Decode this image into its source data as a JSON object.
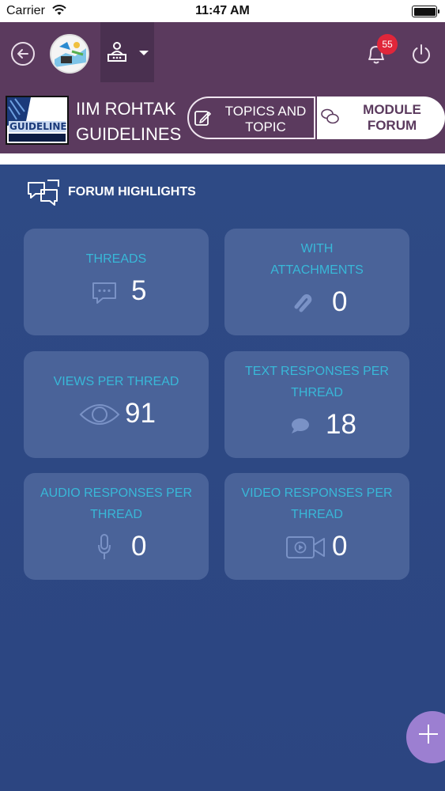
{
  "status_bar": {
    "carrier": "Carrier",
    "time": "11:47 AM"
  },
  "header": {
    "notification_count": "55",
    "course_title": "IIM ROHTAK GUIDELINES",
    "course_thumb_text": "GUIDELINES",
    "tabs": [
      {
        "label": "TOPICS AND TOPIC",
        "active": false
      },
      {
        "label": "MODULE FORUM",
        "active": true
      }
    ]
  },
  "forum_highlights": {
    "title": "FORUM HIGHLIGHTS",
    "cards": [
      {
        "label": "THREADS",
        "value": "5",
        "icon": "chat-bubble-icon"
      },
      {
        "label": "WITH ATTACHMENTS",
        "value": "0",
        "icon": "paperclip-icon"
      },
      {
        "label": "VIEWS PER THREAD",
        "value": "91",
        "icon": "eye-icon"
      },
      {
        "label": "TEXT RESPONSES PER THREAD",
        "value": "18",
        "icon": "comment-icon"
      },
      {
        "label": "AUDIO RESPONSES PER THREAD",
        "value": "0",
        "icon": "microphone-icon"
      },
      {
        "label": "VIDEO RESPONSES PER THREAD",
        "value": "0",
        "icon": "video-camera-icon"
      }
    ]
  },
  "colors": {
    "header": "#5b3a5e",
    "main": "#2e4a85",
    "card": "#4a6399",
    "label": "#38b8d8",
    "badge": "#e0263a",
    "fab": "#9c7fd1"
  }
}
